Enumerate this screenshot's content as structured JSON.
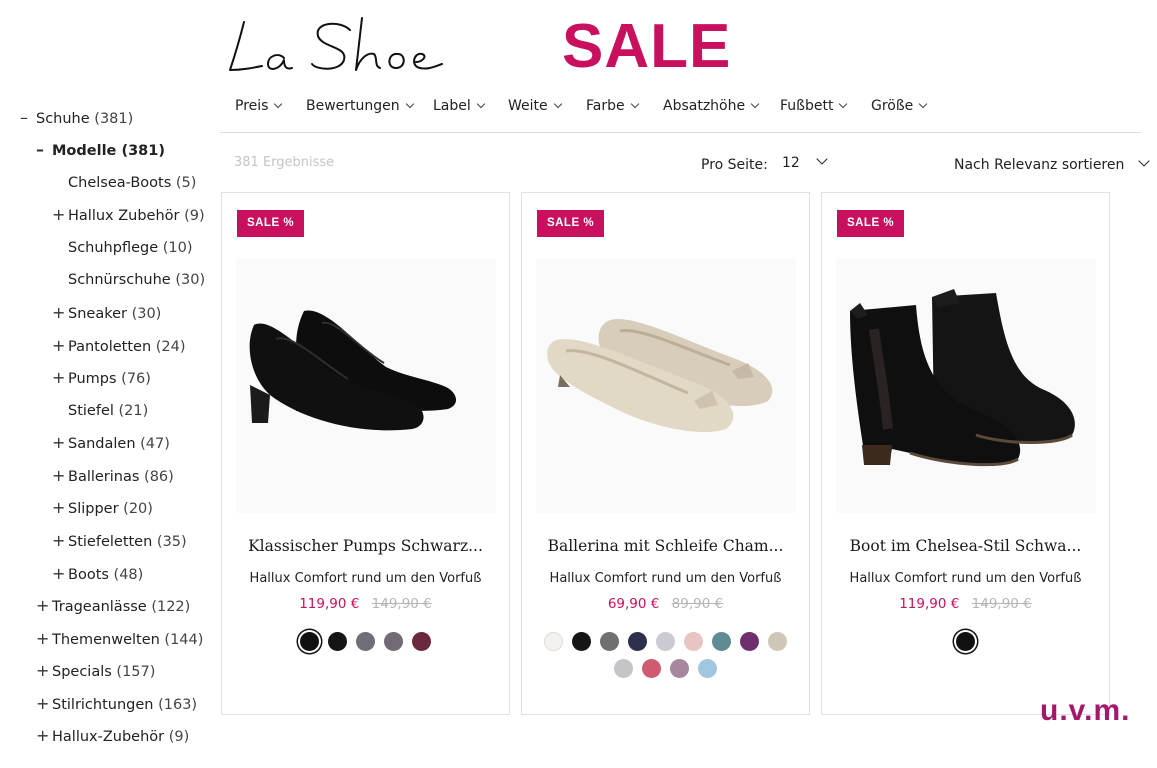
{
  "brand": {
    "logo_text": "La Shoe"
  },
  "headline": "SALE",
  "sidebar": {
    "items": [
      {
        "sign": "–",
        "label": "Schuhe",
        "count": "(381)"
      },
      {
        "sign": "–",
        "label": "Modelle",
        "count": "(381)"
      },
      {
        "sign": "",
        "label": "Chelsea-Boots",
        "count": "(5)"
      },
      {
        "sign": "+",
        "label": "Hallux Zubehör",
        "count": "(9)"
      },
      {
        "sign": "",
        "label": "Schuhpflege",
        "count": "(10)"
      },
      {
        "sign": "",
        "label": "Schnürschuhe",
        "count": "(30)"
      },
      {
        "sign": "+",
        "label": "Sneaker",
        "count": "(30)"
      },
      {
        "sign": "+",
        "label": "Pantoletten",
        "count": "(24)"
      },
      {
        "sign": "+",
        "label": "Pumps",
        "count": "(76)"
      },
      {
        "sign": "",
        "label": "Stiefel",
        "count": "(21)"
      },
      {
        "sign": "+",
        "label": "Sandalen",
        "count": "(47)"
      },
      {
        "sign": "+",
        "label": "Ballerinas",
        "count": "(86)"
      },
      {
        "sign": "+",
        "label": "Slipper",
        "count": "(20)"
      },
      {
        "sign": "+",
        "label": "Stiefeletten",
        "count": "(35)"
      },
      {
        "sign": "+",
        "label": "Boots",
        "count": "(48)"
      },
      {
        "sign": "+",
        "label": "Trageanlässe",
        "count": "(122)"
      },
      {
        "sign": "+",
        "label": "Themenwelten",
        "count": "(144)"
      },
      {
        "sign": "+",
        "label": "Specials",
        "count": "(157)"
      },
      {
        "sign": "+",
        "label": "Stilrichtungen",
        "count": "(163)"
      },
      {
        "sign": "+",
        "label": "Hallux-Zubehör",
        "count": "(9)"
      }
    ]
  },
  "filters": [
    "Preis",
    "Bewertungen",
    "Label",
    "Weite",
    "Farbe",
    "Absatzhöhe",
    "Fußbett",
    "Größe"
  ],
  "toolbar": {
    "results": "381 Ergebnisse",
    "per_page_label": "Pro Seite:",
    "per_page_value": "12",
    "sort_label": "Nach Relevanz sortieren"
  },
  "products": [
    {
      "badge": "SALE %",
      "image_icon": "black-pumps-image",
      "title": "Klassischer Pumps Schwarz...",
      "subtitle": "Hallux Comfort rund um den Vorfuß",
      "price": "119,90 €",
      "old_price": "149,90 €",
      "swatches": [
        "#111111",
        "#151515",
        "#6f6f78",
        "#726a75",
        "#6b2a3c"
      ],
      "selected_swatch": 0
    },
    {
      "badge": "SALE %",
      "image_icon": "champagne-ballerina-image",
      "title": "Ballerina mit Schleife Cham...",
      "subtitle": "Hallux Comfort rund um den Vorfuß",
      "price": "69,90 €",
      "old_price": "89,90 €",
      "swatches": [
        "#f4f1ee",
        "#151515",
        "#707070",
        "#2d2f4c",
        "#c9cad2",
        "#e8c4c2",
        "#5e8c92",
        "#6e2f6e",
        "#cfc6b8",
        "#c6c4c8",
        "#d05a70",
        "#a6879e",
        "#a2c6e0"
      ],
      "selected_swatch": -1
    },
    {
      "badge": "SALE %",
      "image_icon": "black-chelsea-boot-image",
      "title": "Boot im Chelsea-Stil Schwa...",
      "subtitle": "Hallux Comfort rund um den Vorfuß",
      "price": "119,90 €",
      "old_price": "149,90 €",
      "swatches": [
        "#111111"
      ],
      "selected_swatch": 0
    }
  ],
  "more_label": "u.v.m."
}
